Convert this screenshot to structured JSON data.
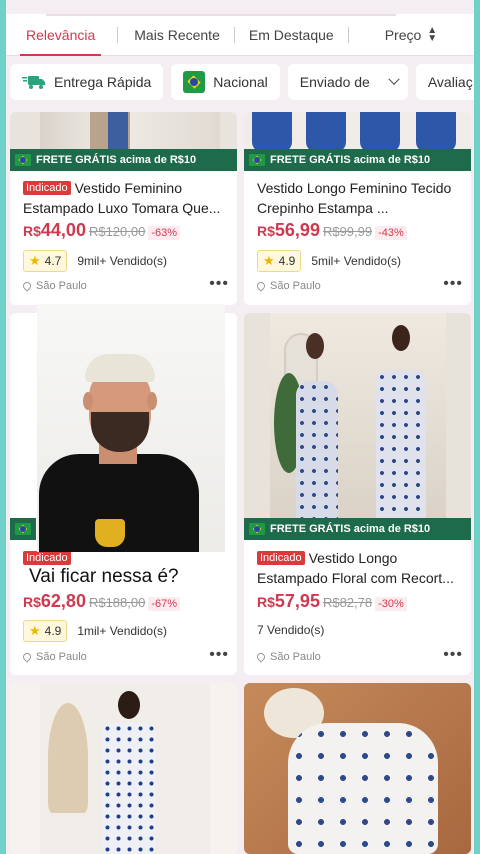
{
  "sort_tabs": [
    "Relevância",
    "Mais Recente",
    "Em Destaque",
    "Preço"
  ],
  "sort_price_icon": "sort-arrows-icon",
  "filters": {
    "fast_delivery": "Entrega Rápida",
    "national": "Nacional",
    "shipped_from": "Enviado de",
    "rating": "Avaliaç"
  },
  "frete_label": "FRETE GRÁTIS acima de R$10",
  "indicado_badge": "Indicado",
  "currency": "R$",
  "products": [
    {
      "title": "Vestido Feminino Estampado Luxo Tomara Que...",
      "badge": true,
      "price": "44,00",
      "old_price": "R$120,00",
      "discount": "-63%",
      "rating": "4.7",
      "sold": "9mil+ Vendido(s)",
      "location": "São Paulo"
    },
    {
      "title": "Vestido Longo Feminino Tecido Crepinho  Estampa ...",
      "badge": false,
      "price": "56,99",
      "old_price": "R$99,99",
      "discount": "-43%",
      "rating": "4.9",
      "sold": "5mil+ Vendido(s)",
      "location": "São Paulo"
    },
    {
      "title": "",
      "badge": true,
      "price": "62,80",
      "old_price": "R$188,00",
      "discount": "-67%",
      "rating": "4.9",
      "sold": "1mil+ Vendido(s)",
      "location": "São Paulo"
    },
    {
      "title": "Vestido Longo Estampado Floral com Recort...",
      "badge": true,
      "price": "57,95",
      "old_price": "R$82,78",
      "discount": "-30%",
      "rating": "",
      "sold": "7 Vendido(s)",
      "location": "São Paulo"
    }
  ],
  "overlay_caption": "Vai ficar nessa é?",
  "more_icon": "more-dots-icon",
  "colors": {
    "accent": "#d0394f",
    "frete_green": "#1d6b4a",
    "border_teal": "#6fd1c8"
  }
}
